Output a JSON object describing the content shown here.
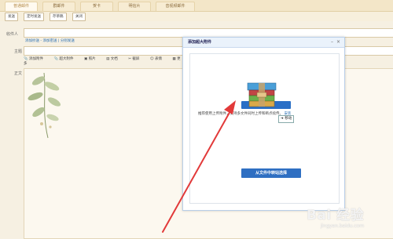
{
  "tabs": [
    "普通邮件",
    "群邮件",
    "贺卡",
    "明信片",
    "音视频邮件"
  ],
  "toolbar": {
    "send": "发送",
    "timed": "定时发送",
    "draft": "存草稿",
    "close": "关闭"
  },
  "form": {
    "recipient_label": "收件人",
    "cc_links": "添加抄送 - 添加密送 | 分别发送",
    "subject_label": "主题",
    "body_label": "正文"
  },
  "format_bar": [
    "添加附件",
    "超大附件",
    "照片",
    "文档",
    "截屏",
    "表情",
    "更多"
  ],
  "dialog": {
    "title": "添加超大附件",
    "desc": "推荐使用上传附件，支持多文件同时上传和断点续传。",
    "install_link": "安装",
    "drag_tip": "移动",
    "pick_button": "从文件中转站选择"
  },
  "colors": {
    "accent": "#2a6fc6",
    "arrow": "#e23a3a"
  },
  "watermark": {
    "main": "Bai 经验",
    "sub": "jingyan.baidu.com"
  }
}
